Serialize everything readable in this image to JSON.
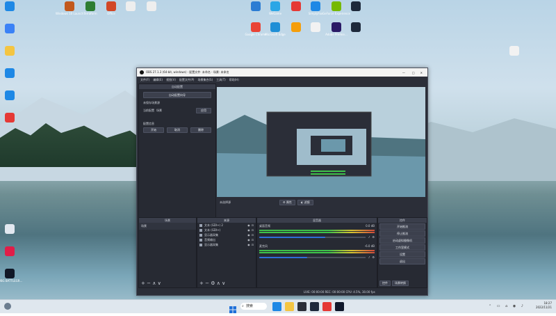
{
  "desktop": {
    "icons_top": [
      {
        "label": "Windows 10 Launch",
        "color": "#c2581c"
      },
      {
        "label": "Terraform",
        "color": "#2e7d32"
      },
      {
        "label": "Office",
        "color": "#d24726"
      },
      {
        "label": "",
        "color": "#eeeeee"
      },
      {
        "label": "",
        "color": "#eeeeee"
      },
      {
        "label": "",
        "color": "#2b7cd3"
      },
      {
        "label": "WeGame",
        "color": "#2aa6e6"
      },
      {
        "label": "",
        "color": "#e53935"
      },
      {
        "label": "SimplyFox",
        "color": "#1e88e5"
      },
      {
        "label": "GeForce Experience",
        "color": "#76b900"
      },
      {
        "label": "",
        "color": "#1e293b"
      }
    ],
    "icons_row2": [
      {
        "label": "Google Chrome",
        "color": "#e94335"
      },
      {
        "label": "Microsoft Edge",
        "color": "#1f8fd6"
      },
      {
        "label": "",
        "color": "#f59e0b"
      },
      {
        "label": "",
        "color": "#f2f2f2"
      },
      {
        "label": "Adobe Premie…",
        "color": "#2a1a66"
      },
      {
        "label": "",
        "color": "#1e293b"
      }
    ],
    "icons_left": [
      {
        "label": "",
        "color": "#1e88e5"
      },
      {
        "label": "",
        "color": "#3b82f6"
      },
      {
        "label": "",
        "color": "#f4c542"
      },
      {
        "label": "",
        "color": "#1e88e5"
      },
      {
        "label": "",
        "color": "#1e88e5"
      },
      {
        "label": "",
        "color": "#e53935"
      },
      {
        "label": "",
        "color": "#e2e8f0"
      },
      {
        "label": "",
        "color": "#e11d48"
      },
      {
        "label": "PUBG BATTLEGR…",
        "color": "#111827"
      }
    ],
    "right_icon": {
      "label": "",
      "color": "#f2f2f2"
    }
  },
  "obs": {
    "title": "OBS 27.1.3 (64-bit, windows) - 配置文件: 未命名 - 场景: 未命名",
    "menu": [
      "文件(F)",
      "编辑(E)",
      "视图(V)",
      "配置文件(P)",
      "场景集合(S)",
      "工具(T)",
      "帮助(H)"
    ],
    "auto_config": {
      "title": "自动配置",
      "button": "自动配置向导",
      "text1": "未保存场景源",
      "text2": "当前配置",
      "text3": "场景",
      "apply": "应用",
      "section": "配置信息",
      "b1": "开始",
      "b2": "取消",
      "b3": "删除"
    },
    "preview_footer": {
      "label": "未选择源",
      "props": "属性",
      "filters": "滤镜"
    },
    "docks": {
      "scenes": {
        "title": "场景",
        "item": "场景"
      },
      "sources": {
        "title": "来源",
        "items": [
          "文本 (GDI+) 2",
          "文本 (GDI+)",
          "显示器采集",
          "音频输出",
          "显示器采集"
        ]
      },
      "mixer": {
        "title": "混音器",
        "tracks": [
          {
            "name": "桌面音频",
            "db": "0.0 dB",
            "level": 0.62
          },
          {
            "name": "麦克风",
            "db": "-6.0 dB",
            "level": 0.45
          }
        ]
      },
      "controls": {
        "title": "控件",
        "buttons": [
          "开始推流",
          "停止推流",
          "启动虚拟摄像机",
          "工作室模式",
          "设置",
          "退出"
        ],
        "tabs": [
          "控件",
          "场景转换"
        ]
      }
    },
    "statusbar": "LIVE: 00:00:00   REC: 00:00:00   CPU: 4.5%, 30.00 fps"
  },
  "taskbar": {
    "search": "搜索",
    "time": "18:27",
    "date": "2022/11/21",
    "pins": [
      "#1e88e5",
      "#f4c542",
      "#2b2e38",
      "#1e293b",
      "#e53935",
      "#0f172a"
    ]
  }
}
